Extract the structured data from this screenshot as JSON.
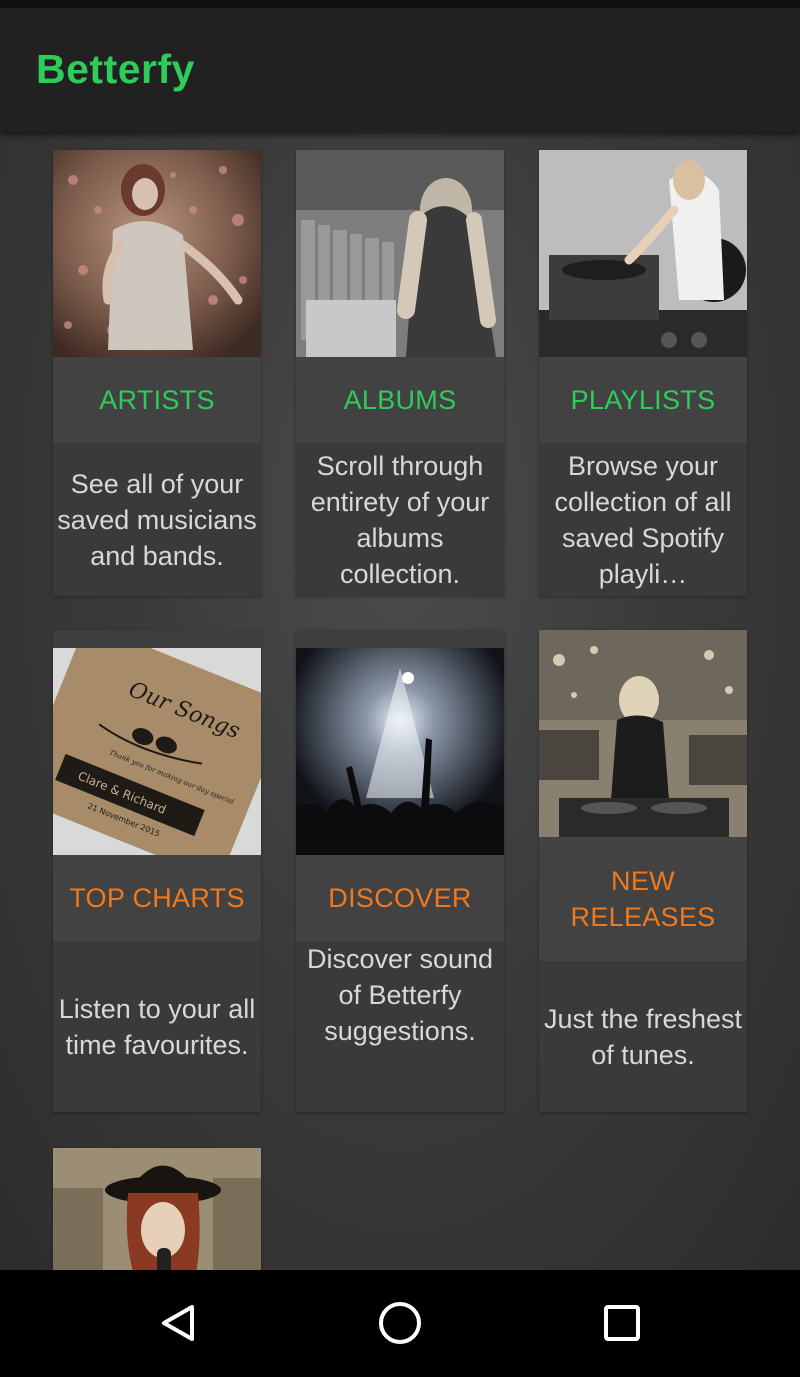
{
  "app": {
    "title": "Betterfy",
    "accent_green": "#2ecc5a",
    "accent_orange": "#f0791e"
  },
  "categories": [
    {
      "title": "ARTISTS",
      "description": "See all of your saved musicians and bands.",
      "title_color": "#2ecc5a",
      "image_icon": "artists-photo-icon"
    },
    {
      "title": "ALBUMS",
      "description": "Scroll through entirety of your albums collection.",
      "title_color": "#2ecc5a",
      "image_icon": "albums-photo-icon"
    },
    {
      "title": "PLAYLISTS",
      "description": "Browse your collection of all saved Spotify playli…",
      "title_color": "#2ecc5a",
      "image_icon": "playlists-photo-icon"
    },
    {
      "title": "TOP CHARTS",
      "description": "Listen to your all time favourites.",
      "title_color": "#f0791e",
      "image_icon": "top-charts-photo-icon",
      "image_text": {
        "line1": "Our Songs",
        "line2": "Thank you for making our day special",
        "line3": "Clare & Richard",
        "line4": "21 November 2015"
      }
    },
    {
      "title": "DISCOVER",
      "description": "Discover sound of Betterfy suggestions.",
      "title_color": "#f0791e",
      "image_icon": "discover-photo-icon"
    },
    {
      "title": "NEW RELEASES",
      "description": "Just the freshest of tunes.",
      "title_color": "#f0791e",
      "image_icon": "new-releases-photo-icon"
    }
  ],
  "partial_tile": {
    "image_icon": "singer-photo-icon"
  },
  "nav": {
    "back_icon": "back-triangle-icon",
    "home_icon": "home-circle-icon",
    "recents_icon": "recents-square-icon"
  }
}
